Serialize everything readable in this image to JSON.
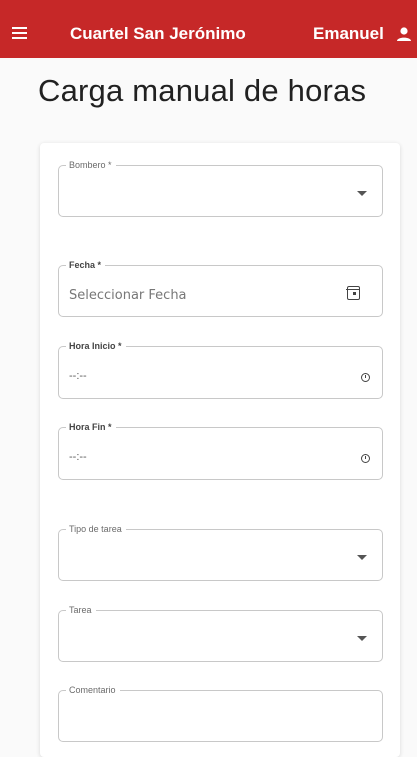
{
  "header": {
    "title": "Cuartel San Jerónimo",
    "user": "Emanuel",
    "menu_icon": "hamburger-menu-icon",
    "user_icon": "person-icon",
    "bg_color": "#c62828"
  },
  "page": {
    "title": "Carga manual de horas"
  },
  "form": {
    "bombero": {
      "label": "Bombero *",
      "value": ""
    },
    "fecha": {
      "label": "Fecha *",
      "placeholder": "Seleccionar Fecha",
      "icon": "calendar-icon"
    },
    "hora_inicio": {
      "label": "Hora Inicio *",
      "value": "--:--",
      "icon": "clock-icon"
    },
    "hora_fin": {
      "label": "Hora Fin *",
      "value": "--:--",
      "icon": "clock-icon"
    },
    "tipo_tarea": {
      "label": "Tipo de tarea",
      "value": ""
    },
    "tarea": {
      "label": "Tarea",
      "value": ""
    },
    "comentario": {
      "label": "Comentario",
      "value": ""
    }
  }
}
